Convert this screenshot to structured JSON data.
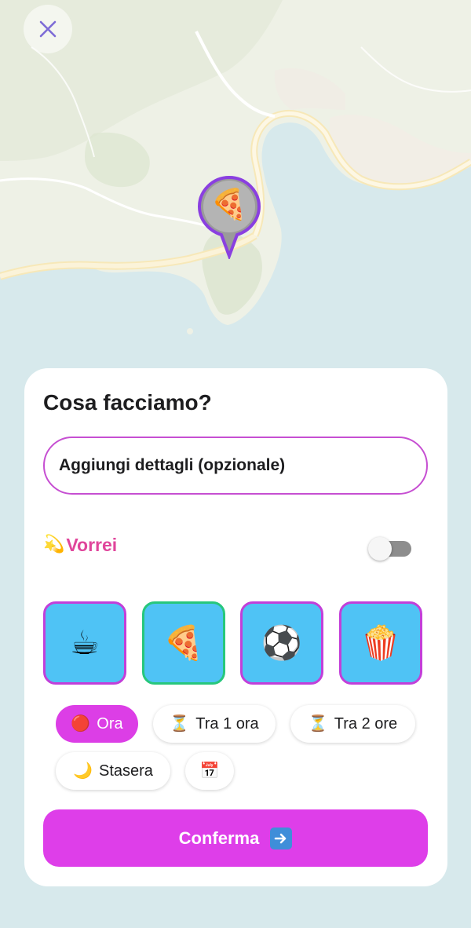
{
  "map": {
    "pin_emoji": "🍕"
  },
  "card": {
    "title": "Cosa facciamo?",
    "details_placeholder": "Aggiungi dettagli (opzionale)",
    "vorrei": {
      "emoji": "💫",
      "label": "Vorrei",
      "toggle_on": false
    },
    "activities": [
      {
        "emoji": "☕",
        "selected": false
      },
      {
        "emoji": "🍕",
        "selected": true
      },
      {
        "emoji": "⚽",
        "selected": false
      },
      {
        "emoji": "🍿",
        "selected": false
      }
    ],
    "time_chips": [
      {
        "emoji": "🔴",
        "label": "Ora",
        "active": true
      },
      {
        "emoji": "⏳",
        "label": "Tra 1 ora",
        "active": false
      },
      {
        "emoji": "⏳",
        "label": "Tra 2 ore",
        "active": false
      },
      {
        "emoji": "🌙",
        "label": "Stasera",
        "active": false
      },
      {
        "emoji": "📅",
        "label": "",
        "active": false
      }
    ],
    "confirm_label": "Conferma"
  },
  "colors": {
    "accent": "#de3ee9",
    "input_border": "#c64fd2",
    "vorrei_text": "#e0459b",
    "tile_bg": "#4fc3f5",
    "tile_border": "#c23fd9",
    "tile_selected_border": "#27c77c",
    "sea": "#d7e9ec",
    "land": "#eef1e6"
  }
}
